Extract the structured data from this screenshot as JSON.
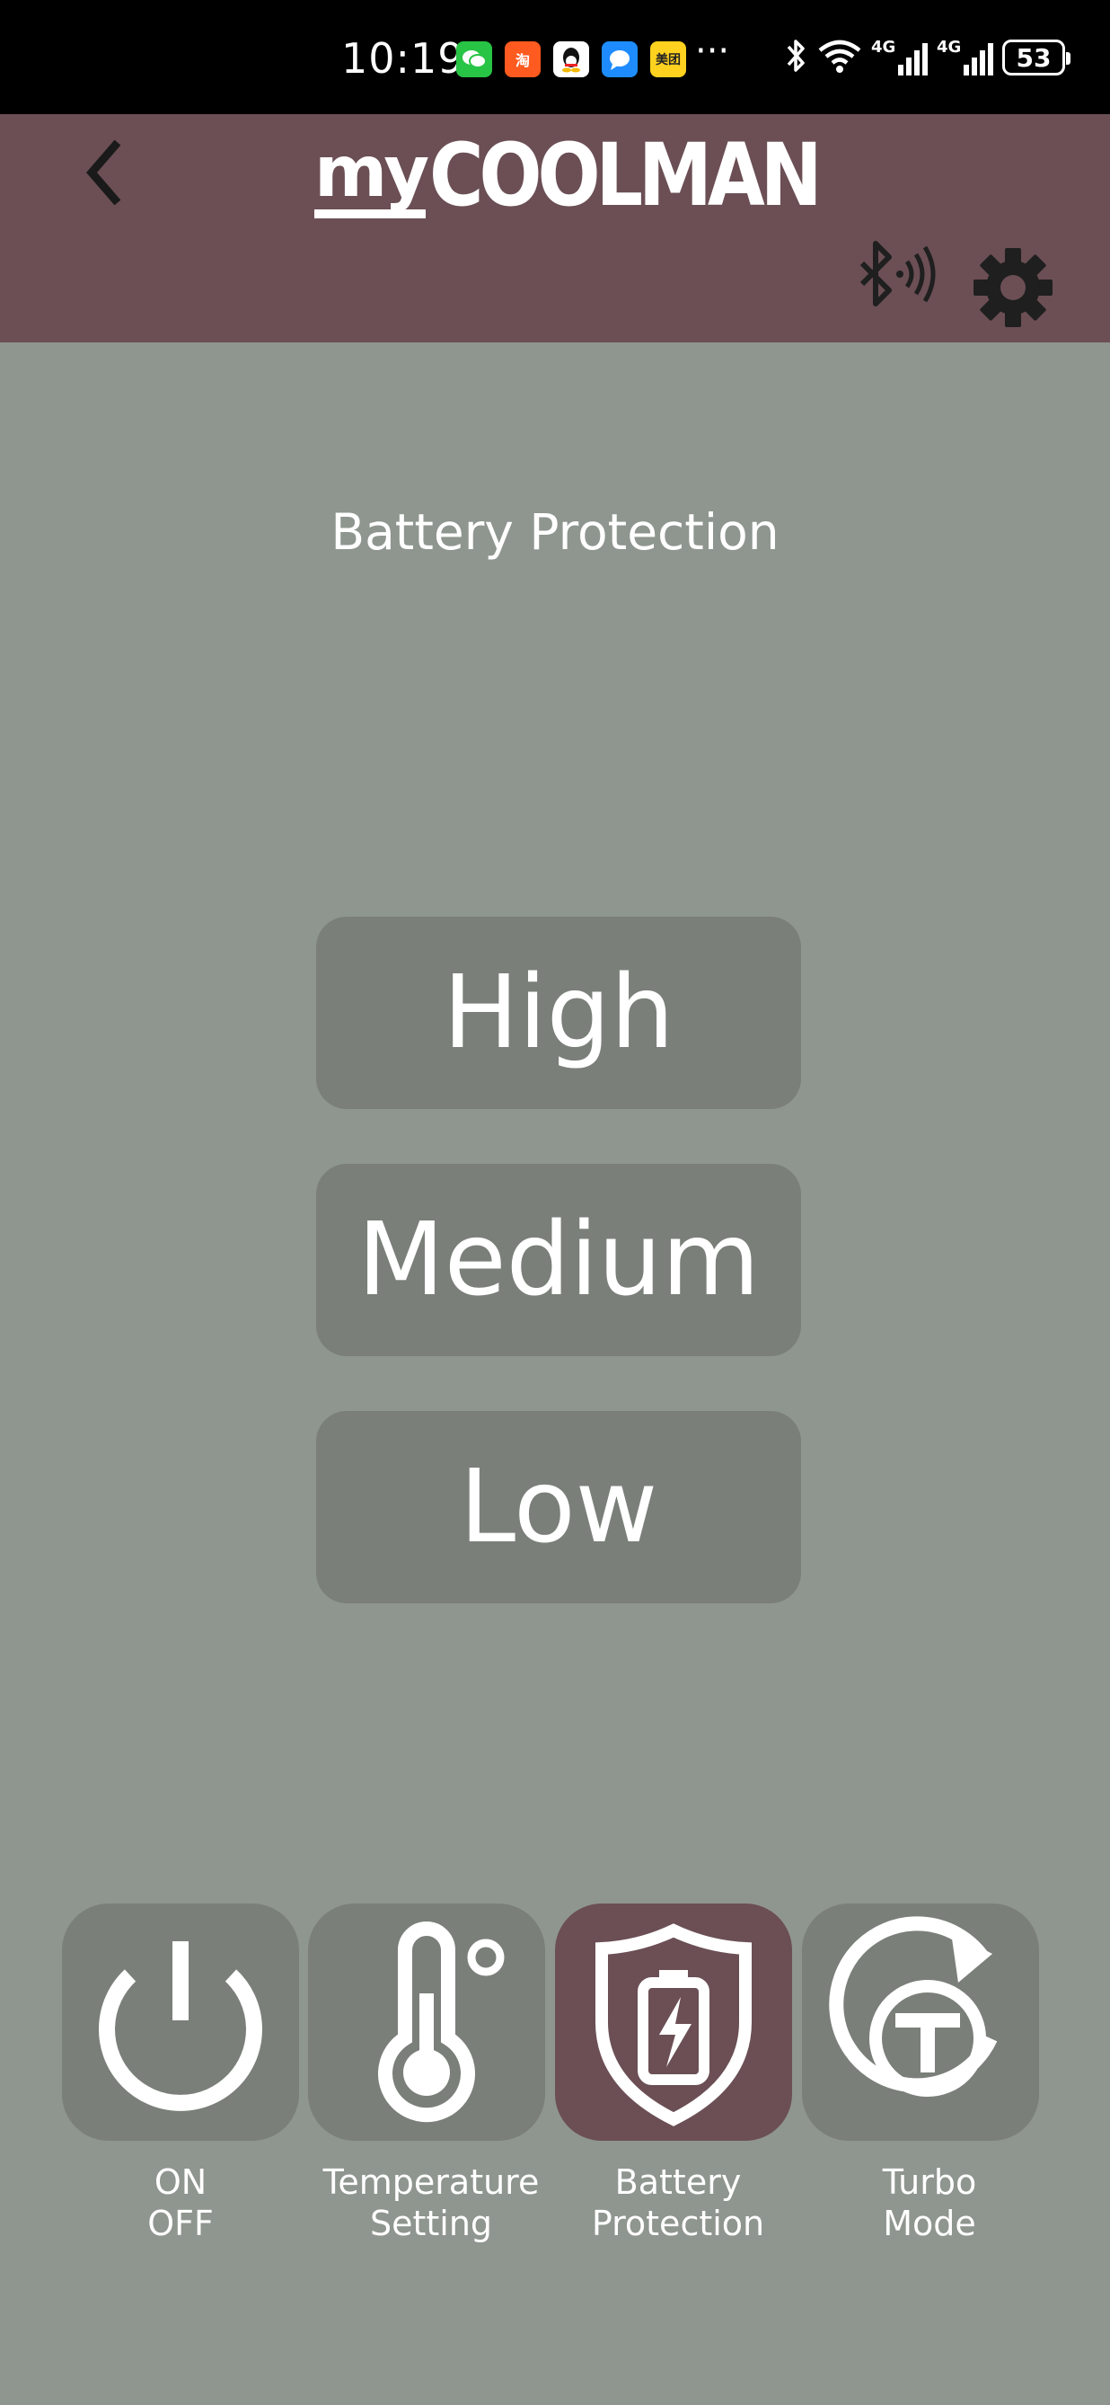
{
  "status_bar": {
    "time": "10:19",
    "apps": [
      {
        "icon": "wechat-icon",
        "color": "#28c445",
        "text": ""
      },
      {
        "icon": "taobao-icon",
        "color": "#ff5a1f",
        "text": "淘"
      },
      {
        "icon": "qq-icon",
        "color": "#ffffff",
        "text": ""
      },
      {
        "icon": "message-icon",
        "color": "#1e8cff",
        "text": ""
      },
      {
        "icon": "meituan-icon",
        "color": "#ffd21f",
        "text": "美团"
      }
    ],
    "more": "···",
    "signal_1_label": "4G",
    "signal_2_label": "4G",
    "battery_level": "53"
  },
  "header": {
    "logo_prefix": "my",
    "logo_main": "COOLMAN",
    "color": "#6b4f55"
  },
  "main": {
    "title": "Battery Protection",
    "levels": {
      "high": "High",
      "medium": "Medium",
      "low": "Low"
    }
  },
  "nav": {
    "on_off": {
      "line1": "ON",
      "line2": "OFF",
      "icon": "power-icon"
    },
    "temperature": {
      "line1": "Temperature",
      "line2": "Setting",
      "icon": "thermometer-icon"
    },
    "battery": {
      "line1": "Battery",
      "line2": "Protection",
      "icon": "battery-shield-icon",
      "active": true
    },
    "turbo": {
      "line1": "Turbo",
      "line2": "Mode",
      "icon": "turbo-icon"
    }
  },
  "colors": {
    "background": "#8f958f",
    "button": "#7a7f79",
    "accent": "#6b4f55"
  }
}
